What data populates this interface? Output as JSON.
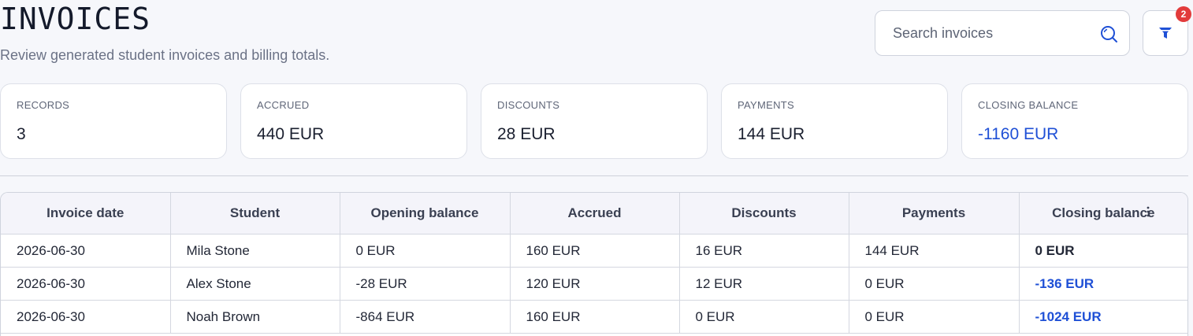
{
  "header": {
    "title": "INVOICES",
    "subtitle": "Review generated student invoices and billing totals."
  },
  "search": {
    "placeholder": "Search invoices",
    "value": ""
  },
  "filter": {
    "badge_count": "2"
  },
  "summary_cards": [
    {
      "label": "RECORDS",
      "value": "3",
      "highlight": false
    },
    {
      "label": "ACCRUED",
      "value": "440 EUR",
      "highlight": false
    },
    {
      "label": "DISCOUNTS",
      "value": "28 EUR",
      "highlight": false
    },
    {
      "label": "PAYMENTS",
      "value": "144 EUR",
      "highlight": false
    },
    {
      "label": "CLOSING BALANCE",
      "value": "-1160 EUR",
      "highlight": true
    }
  ],
  "table": {
    "columns": [
      "Invoice date",
      "Student",
      "Opening balance",
      "Accrued",
      "Discounts",
      "Payments",
      "Closing balance"
    ],
    "rows": [
      [
        "2026-06-30",
        "Mila Stone",
        "0 EUR",
        "160 EUR",
        "16 EUR",
        "144 EUR",
        "0 EUR"
      ],
      [
        "2026-06-30",
        "Alex Stone",
        "-28 EUR",
        "120 EUR",
        "12 EUR",
        "0 EUR",
        "-136 EUR"
      ],
      [
        "2026-06-30",
        "Noah Brown",
        "-864 EUR",
        "160 EUR",
        "0 EUR",
        "0 EUR",
        "-1024 EUR"
      ]
    ]
  },
  "colors": {
    "accent": "#1f50d6",
    "badge": "#e23b3b"
  }
}
